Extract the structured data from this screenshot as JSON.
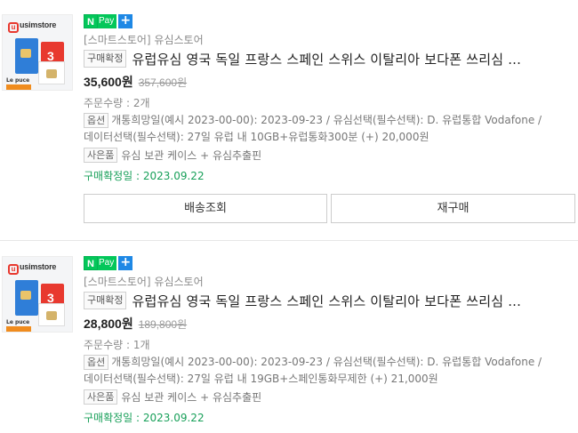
{
  "orders": [
    {
      "thumb": {
        "brand": "usimstore",
        "brand_mark": "u",
        "caption": "Le puce"
      },
      "npay": {
        "n": "N",
        "pay": "Pay",
        "plus": "+"
      },
      "store": "[스마트스토어] 유심스토어",
      "status_tag": "구매확정",
      "title": "유럽유심 영국 독일 프랑스 스페인 스위스 이탈리아 보다폰 쓰리심 ...",
      "price": "35,600원",
      "original_price": "357,600원",
      "quantity": "주문수량 : 2개",
      "option_tag": "옵션",
      "option_line1": "개통희망일(예시 2023-00-00): 2023-09-23 / 유심선택(필수선택): D. 유럽통합 Vodafone /",
      "option_line2": "데이터선택(필수선택): 27일 유럽 내 10GB+유럽통화300분 (+) 20,000원",
      "gift_tag": "사은품",
      "gift": "유심 보관 케이스 + 유심추출핀",
      "confirm_date": "구매확정일 : 2023.09.22",
      "buttons": {
        "track": "배송조회",
        "reorder": "재구매"
      }
    },
    {
      "thumb": {
        "brand": "usimstore",
        "brand_mark": "u",
        "caption": "Le puce"
      },
      "npay": {
        "n": "N",
        "pay": "Pay",
        "plus": "+"
      },
      "store": "[스마트스토어] 유심스토어",
      "status_tag": "구매확정",
      "title": "유럽유심 영국 독일 프랑스 스페인 스위스 이탈리아 보다폰 쓰리심 ...",
      "price": "28,800원",
      "original_price": "189,800원",
      "quantity": "주문수량 : 1개",
      "option_tag": "옵션",
      "option_line1": "개통희망일(예시 2023-00-00): 2023-09-23 / 유심선택(필수선택): D. 유럽통합 Vodafone /",
      "option_line2": "데이터선택(필수선택): 27일 유럽 내 19GB+스페인통화무제한 (+) 21,000원",
      "gift_tag": "사은품",
      "gift": "유심 보관 케이스 + 유심추출핀",
      "confirm_date": "구매확정일 : 2023.09.22"
    }
  ]
}
